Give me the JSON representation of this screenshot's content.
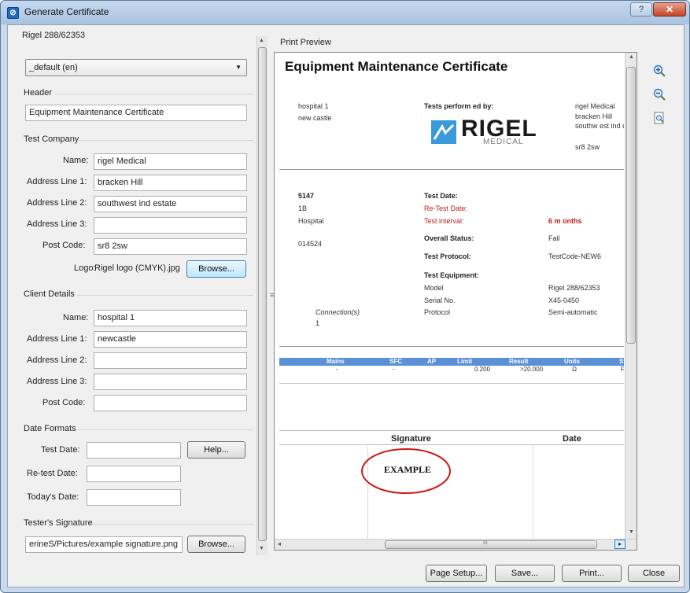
{
  "window": {
    "title": "Generate Certificate",
    "help_glyph": "?",
    "close_glyph": "✕"
  },
  "left": {
    "device_label": "Rigel 288/62353",
    "template_select": "_default (en)",
    "header_group": "Header",
    "header_value": "Equipment Maintenance Certificate",
    "test_company": {
      "group": "Test Company",
      "name_label": "Name:",
      "name": "rigel Medical",
      "addr1_label": "Address Line 1:",
      "addr1": "bracken Hill",
      "addr2_label": "Address Line 2:",
      "addr2": "southwest ind estate",
      "addr3_label": "Address Line 3:",
      "addr3": "",
      "post_label": "Post Code:",
      "post": "sr8 2sw",
      "logo_label": "Logo:",
      "logo": "Rigel logo (CMYK).jpg",
      "browse": "Browse..."
    },
    "client": {
      "group": "Client Details",
      "name_label": "Name:",
      "name": "hospital 1",
      "addr1_label": "Address Line 1:",
      "addr1": "newcastle",
      "addr2_label": "Address Line 2:",
      "addr2": "",
      "addr3_label": "Address Line 3:",
      "addr3": "",
      "post_label": "Post Code:",
      "post": ""
    },
    "dates": {
      "group": "Date Formats",
      "test_label": "Test Date:",
      "test": "",
      "retest_label": "Re-test Date:",
      "retest": "",
      "today_label": "Today's Date:",
      "today": "",
      "help": "Help..."
    },
    "signature": {
      "group": "Tester's Signature",
      "path": "erineS/Pictures/example signature.png",
      "browse": "Browse..."
    }
  },
  "preview": {
    "label": "Print Preview",
    "title": "Equipment Maintenance Certificate",
    "client_lines": [
      "hospital 1",
      "new castle"
    ],
    "performed_by": "Tests perform ed by:",
    "logo_text": "RIGEL",
    "logo_sub": "MEDICAL",
    "company_lines": [
      "rigel Medical",
      "bracken Hill",
      "southw est ind e",
      "",
      "sr8 2sw"
    ],
    "asset": {
      "id": "5147",
      "line2": "1B",
      "line3": "Hospital",
      "line4": "014524"
    },
    "test_date_label": "Test Date:",
    "retest_label": "Re-Test Date:",
    "interval_label": "Test interval:",
    "interval_value": "6 m onths",
    "status_label": "Overall Status:",
    "status_value": "Fail",
    "protocol_label": "Test Protocol:",
    "protocol_value": "TestCode-NEW6",
    "equipment_label": "Test Equipment:",
    "model_label": "Model",
    "model_value": "Rigel 288/62353",
    "serial_label": "Serial No.",
    "serial_value": "X45-0450",
    "proto_label": "Protocol",
    "proto_value": "Semi-automatic",
    "connection_label": "Connection(s)",
    "connection_value": "1",
    "table": {
      "headers": [
        "Mains",
        "SFC",
        "AP",
        "Limit",
        "Result",
        "Units",
        "St"
      ],
      "row": [
        "-",
        "-",
        "",
        "0.200",
        ">20.000",
        "Ω",
        "F"
      ]
    },
    "sig_header": "Signature",
    "date_header": "Date",
    "stamp": "EXAMPLE",
    "scroll_dots": "III"
  },
  "buttons": {
    "page_setup": "Page Setup...",
    "save": "Save...",
    "print": "Print...",
    "close": "Close"
  },
  "colors": {
    "table_header": "#5b8fd6",
    "accent_red": "#c21a1a",
    "rigel_blue": "#3a9ad9"
  }
}
